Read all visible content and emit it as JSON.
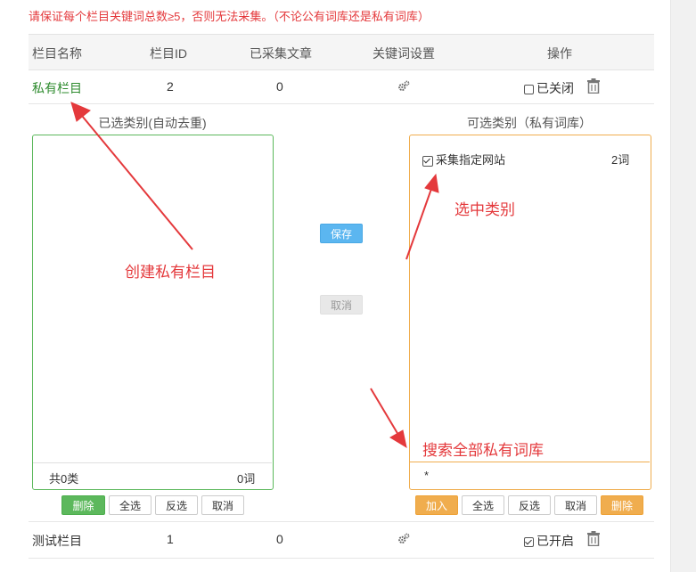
{
  "warning": "请保证每个栏目关键词总数≥5，否则无法采集。（不论公有词库还是私有词库）",
  "table": {
    "headers": [
      "栏目名称",
      "栏目ID",
      "已采集文章",
      "关键词设置",
      "操作"
    ],
    "rows": [
      {
        "name": "私有栏目",
        "id": "2",
        "count": "0",
        "status": "已关闭",
        "checked": false
      },
      {
        "name": "测试栏目",
        "id": "1",
        "count": "0",
        "status": "已开启",
        "checked": true
      }
    ]
  },
  "left_panel": {
    "title": "已选类别(自动去重)",
    "footer_left": "共0类",
    "footer_right": "0词",
    "buttons": {
      "delete": "删除",
      "select_all": "全选",
      "invert": "反选",
      "cancel": "取消"
    }
  },
  "middle": {
    "save": "保存",
    "cancel": "取消"
  },
  "right_panel": {
    "title": "可选类别（私有词库）",
    "item_label": "采集指定网站",
    "item_count": "2词",
    "search_value": "*",
    "buttons": {
      "add": "加入",
      "select_all": "全选",
      "invert": "反选",
      "cancel": "取消",
      "delete": "删除"
    }
  },
  "annotations": {
    "create": "创建私有栏目",
    "select": "选中类别",
    "search": "搜索全部私有词库"
  },
  "colors": {
    "annotation": "#e4393c",
    "green": "#5cb85c",
    "orange": "#f0ad4e",
    "blue": "#5bb6f0"
  }
}
